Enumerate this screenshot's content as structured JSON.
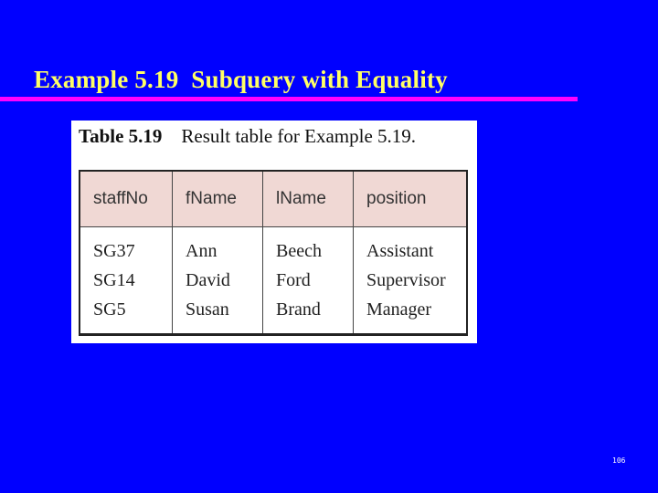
{
  "slide": {
    "title": "Example 5.19  Subquery with Equality",
    "page_number": "106",
    "colors": {
      "background": "#0000ff",
      "title": "#ffff66",
      "rule": "#ff00ff",
      "header_fill": "#f0d8d4"
    }
  },
  "figure": {
    "caption_label": "Table 5.19",
    "caption_text": "Result table for Example 5.19.",
    "columns": [
      "staffNo",
      "fName",
      "lName",
      "position"
    ],
    "rows": [
      [
        "SG37",
        "Ann",
        "Beech",
        "Assistant"
      ],
      [
        "SG14",
        "David",
        "Ford",
        "Supervisor"
      ],
      [
        "SG5",
        "Susan",
        "Brand",
        "Manager"
      ]
    ]
  }
}
